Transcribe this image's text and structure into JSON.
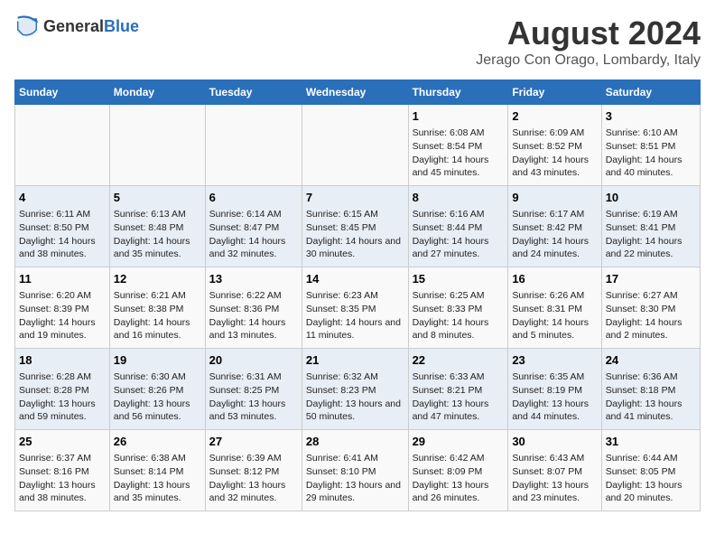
{
  "header": {
    "logo_general": "General",
    "logo_blue": "Blue",
    "title": "August 2024",
    "subtitle": "Jerago Con Orago, Lombardy, Italy"
  },
  "weekdays": [
    "Sunday",
    "Monday",
    "Tuesday",
    "Wednesday",
    "Thursday",
    "Friday",
    "Saturday"
  ],
  "weeks": [
    [
      {
        "day": "",
        "content": ""
      },
      {
        "day": "",
        "content": ""
      },
      {
        "day": "",
        "content": ""
      },
      {
        "day": "",
        "content": ""
      },
      {
        "day": "1",
        "content": "Sunrise: 6:08 AM\nSunset: 8:54 PM\nDaylight: 14 hours and 45 minutes."
      },
      {
        "day": "2",
        "content": "Sunrise: 6:09 AM\nSunset: 8:52 PM\nDaylight: 14 hours and 43 minutes."
      },
      {
        "day": "3",
        "content": "Sunrise: 6:10 AM\nSunset: 8:51 PM\nDaylight: 14 hours and 40 minutes."
      }
    ],
    [
      {
        "day": "4",
        "content": "Sunrise: 6:11 AM\nSunset: 8:50 PM\nDaylight: 14 hours and 38 minutes."
      },
      {
        "day": "5",
        "content": "Sunrise: 6:13 AM\nSunset: 8:48 PM\nDaylight: 14 hours and 35 minutes."
      },
      {
        "day": "6",
        "content": "Sunrise: 6:14 AM\nSunset: 8:47 PM\nDaylight: 14 hours and 32 minutes."
      },
      {
        "day": "7",
        "content": "Sunrise: 6:15 AM\nSunset: 8:45 PM\nDaylight: 14 hours and 30 minutes."
      },
      {
        "day": "8",
        "content": "Sunrise: 6:16 AM\nSunset: 8:44 PM\nDaylight: 14 hours and 27 minutes."
      },
      {
        "day": "9",
        "content": "Sunrise: 6:17 AM\nSunset: 8:42 PM\nDaylight: 14 hours and 24 minutes."
      },
      {
        "day": "10",
        "content": "Sunrise: 6:19 AM\nSunset: 8:41 PM\nDaylight: 14 hours and 22 minutes."
      }
    ],
    [
      {
        "day": "11",
        "content": "Sunrise: 6:20 AM\nSunset: 8:39 PM\nDaylight: 14 hours and 19 minutes."
      },
      {
        "day": "12",
        "content": "Sunrise: 6:21 AM\nSunset: 8:38 PM\nDaylight: 14 hours and 16 minutes."
      },
      {
        "day": "13",
        "content": "Sunrise: 6:22 AM\nSunset: 8:36 PM\nDaylight: 14 hours and 13 minutes."
      },
      {
        "day": "14",
        "content": "Sunrise: 6:23 AM\nSunset: 8:35 PM\nDaylight: 14 hours and 11 minutes."
      },
      {
        "day": "15",
        "content": "Sunrise: 6:25 AM\nSunset: 8:33 PM\nDaylight: 14 hours and 8 minutes."
      },
      {
        "day": "16",
        "content": "Sunrise: 6:26 AM\nSunset: 8:31 PM\nDaylight: 14 hours and 5 minutes."
      },
      {
        "day": "17",
        "content": "Sunrise: 6:27 AM\nSunset: 8:30 PM\nDaylight: 14 hours and 2 minutes."
      }
    ],
    [
      {
        "day": "18",
        "content": "Sunrise: 6:28 AM\nSunset: 8:28 PM\nDaylight: 13 hours and 59 minutes."
      },
      {
        "day": "19",
        "content": "Sunrise: 6:30 AM\nSunset: 8:26 PM\nDaylight: 13 hours and 56 minutes."
      },
      {
        "day": "20",
        "content": "Sunrise: 6:31 AM\nSunset: 8:25 PM\nDaylight: 13 hours and 53 minutes."
      },
      {
        "day": "21",
        "content": "Sunrise: 6:32 AM\nSunset: 8:23 PM\nDaylight: 13 hours and 50 minutes."
      },
      {
        "day": "22",
        "content": "Sunrise: 6:33 AM\nSunset: 8:21 PM\nDaylight: 13 hours and 47 minutes."
      },
      {
        "day": "23",
        "content": "Sunrise: 6:35 AM\nSunset: 8:19 PM\nDaylight: 13 hours and 44 minutes."
      },
      {
        "day": "24",
        "content": "Sunrise: 6:36 AM\nSunset: 8:18 PM\nDaylight: 13 hours and 41 minutes."
      }
    ],
    [
      {
        "day": "25",
        "content": "Sunrise: 6:37 AM\nSunset: 8:16 PM\nDaylight: 13 hours and 38 minutes."
      },
      {
        "day": "26",
        "content": "Sunrise: 6:38 AM\nSunset: 8:14 PM\nDaylight: 13 hours and 35 minutes."
      },
      {
        "day": "27",
        "content": "Sunrise: 6:39 AM\nSunset: 8:12 PM\nDaylight: 13 hours and 32 minutes."
      },
      {
        "day": "28",
        "content": "Sunrise: 6:41 AM\nSunset: 8:10 PM\nDaylight: 13 hours and 29 minutes."
      },
      {
        "day": "29",
        "content": "Sunrise: 6:42 AM\nSunset: 8:09 PM\nDaylight: 13 hours and 26 minutes."
      },
      {
        "day": "30",
        "content": "Sunrise: 6:43 AM\nSunset: 8:07 PM\nDaylight: 13 hours and 23 minutes."
      },
      {
        "day": "31",
        "content": "Sunrise: 6:44 AM\nSunset: 8:05 PM\nDaylight: 13 hours and 20 minutes."
      }
    ]
  ]
}
